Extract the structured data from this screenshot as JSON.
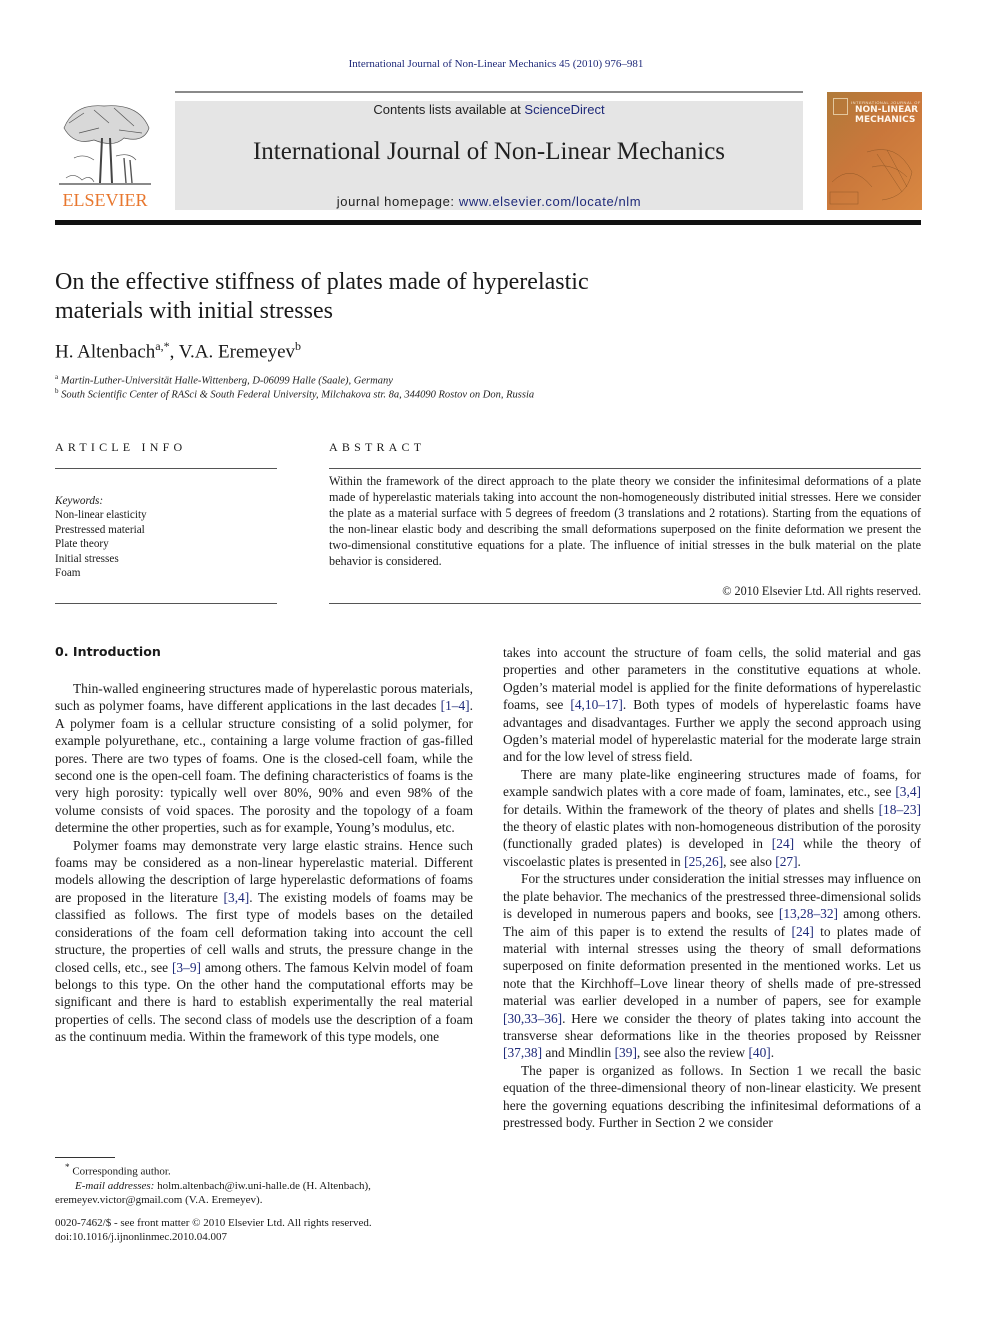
{
  "running_head": "International Journal of Non-Linear Mechanics 45 (2010) 976–981",
  "masthead": {
    "contents_prefix": "Contents lists available at ",
    "contents_link": "ScienceDirect",
    "journal_title": "International Journal of Non-Linear Mechanics",
    "homepage_prefix": "journal homepage: ",
    "homepage_link": "www.elsevier.com/locate/nlm",
    "publisher_logo_text": "ELSEVIER",
    "cover_small_text": "INTERNATIONAL JOURNAL OF",
    "cover_title_line1": "NON-LINEAR",
    "cover_title_line2": "MECHANICS",
    "colors": {
      "link": "#1f2a7a",
      "elsevier_orange": "#e8772e",
      "cover_orange": "#c9773b",
      "masthead_bg": "#e5e5e5"
    }
  },
  "article": {
    "title_line1": "On the effective stiffness of plates made of hyperelastic",
    "title_line2": "materials with initial stresses",
    "authors": [
      {
        "name": "H. Altenbach",
        "marks": "a,*"
      },
      {
        "name": "V.A. Eremeyev",
        "marks": "b"
      }
    ],
    "author_separator": ", ",
    "affiliations": [
      {
        "mark": "a",
        "text": "Martin-Luther-Universität Halle-Wittenberg, D-06099 Halle (Saale), Germany"
      },
      {
        "mark": "b",
        "text": "South Scientific Center of RASci & South Federal University, Milchakova str. 8a, 344090 Rostov on Don, Russia"
      }
    ]
  },
  "article_info": {
    "heading": "ARTICLE INFO",
    "keywords_label": "Keywords:",
    "keywords": [
      "Non-linear elasticity",
      "Prestressed material",
      "Plate theory",
      "Initial stresses",
      "Foam"
    ]
  },
  "abstract": {
    "heading": "ABSTRACT",
    "text": "Within the framework of the direct approach to the plate theory we consider the infinitesimal deformations of a plate made of hyperelastic materials taking into account the non-homogeneously distributed initial stresses. Here we consider the plate as a material surface with 5 degrees of freedom (3 translations and 2 rotations). Starting from the equations of the non-linear elastic body and describing the small deformations superposed on the finite deformation we present the two-dimensional constitutive equations for a plate. The influence of initial stresses in the bulk material on the plate behavior is considered.",
    "copyright": "© 2010 Elsevier Ltd. All rights reserved."
  },
  "introduction": {
    "heading": "0.  Introduction",
    "left_column": [
      [
        {
          "t": "Thin-walled engineering structures made of hyperelastic porous materials, such as polymer foams, have different applications in the last decades "
        },
        {
          "ref": "[1–4]"
        },
        {
          "t": ". A polymer foam is a cellular structure consisting of a solid polymer, for example polyurethane, etc., containing a large volume fraction of gas-filled pores. There are two types of foams. One is the closed-cell foam, while the second one is the open-cell foam. The defining characteristics of foams is the very high porosity: typically well over 80%, 90% and even 98% of the volume consists of void spaces. The porosity and the topology of a foam determine the other properties, such as for example, Young’s modulus, etc."
        }
      ],
      [
        {
          "t": "Polymer foams may demonstrate very large elastic strains. Hence such foams may be considered as a non-linear hyperelastic material. Different models allowing the description of large hyperelastic deformations of foams are proposed in the literature "
        },
        {
          "ref": "[3,4]"
        },
        {
          "t": ". The existing models of foams may be classified as follows. The first type of models bases on the detailed considerations of the foam cell deformation taking into account the cell structure, the properties of cell walls and struts, the pressure change in the closed cells, etc., see "
        },
        {
          "ref": "[3–9]"
        },
        {
          "t": " among others. The famous Kelvin model of foam belongs to this type. On the other hand the computational efforts may be significant and there is hard to establish experimentally the real material properties of cells. The second class of models use the description of a foam as the continuum media. Within the framework of this type models, one"
        }
      ]
    ],
    "right_column": [
      [
        {
          "t": "takes into account the structure of foam cells, the solid material and gas properties and other parameters in the constitutive equations at whole. Ogden’s material model is applied for the finite deformations of hyperelastic foams, see "
        },
        {
          "ref": "[4,10–17]"
        },
        {
          "t": ". Both types of models of hyperelastic foams have advantages and disadvantages. Further we apply the second approach using Ogden’s material model of hyperelastic material for the moderate large strain and for the low level of stress field."
        }
      ],
      [
        {
          "t": "There are many plate-like engineering structures made of foams, for example sandwich plates with a core made of foam, laminates, etc., see "
        },
        {
          "ref": "[3,4]"
        },
        {
          "t": " for details. Within the framework of the theory of plates and shells "
        },
        {
          "ref": "[18–23]"
        },
        {
          "t": " the theory of elastic plates with non-homogeneous distribution of the porosity (functionally graded plates) is developed in "
        },
        {
          "ref": "[24]"
        },
        {
          "t": " while the theory of viscoelastic plates is presented in "
        },
        {
          "ref": "[25,26]"
        },
        {
          "t": ", see also "
        },
        {
          "ref": "[27]"
        },
        {
          "t": "."
        }
      ],
      [
        {
          "t": "For the structures under consideration the initial stresses may influence on the plate behavior. The mechanics of the prestressed three-dimensional solids is developed in numerous papers and books, see "
        },
        {
          "ref": "[13,28–32]"
        },
        {
          "t": " among others. The aim of this paper is to extend the results of "
        },
        {
          "ref": "[24]"
        },
        {
          "t": " to plates made of material with internal stresses using the theory of small deformations superposed on finite deformation presented in the mentioned works. Let us note that the Kirchhoff–Love linear theory of shells made of pre-stressed material was earlier developed in a number of papers, see for example "
        },
        {
          "ref": "[30,33–36]"
        },
        {
          "t": ". Here we consider the theory of plates taking into account the transverse shear deformations like in the theories proposed by Reissner "
        },
        {
          "ref": "[37,38]"
        },
        {
          "t": " and Mindlin "
        },
        {
          "ref": "[39]"
        },
        {
          "t": ", see also the review "
        },
        {
          "ref": "[40]"
        },
        {
          "t": "."
        }
      ],
      [
        {
          "t": "The paper is organized as follows. In Section 1 we recall the basic equation of the three-dimensional theory of non-linear elasticity. We present here the governing equations describing the infinitesimal deformations of a prestressed body. Further in Section 2 we consider"
        }
      ]
    ]
  },
  "footnotes": {
    "corresponding_mark": "*",
    "corresponding_text": "Corresponding author.",
    "email_label": "E-mail addresses:",
    "email_1": "holm.altenbach@iw.uni-halle.de",
    "email_1_owner": " (H. Altenbach),",
    "email_2": "eremeyev.victor@gmail.com",
    "email_2_owner": " (V.A. Eremeyev)."
  },
  "front_matter": {
    "issn_line": "0020-7462/$ - see front matter © 2010 Elsevier Ltd. All rights reserved.",
    "doi": "doi:10.1016/j.ijnonlinmec.2010.04.007"
  }
}
